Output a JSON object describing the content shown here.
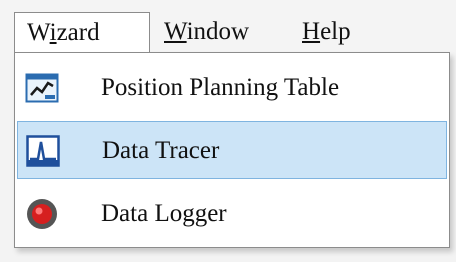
{
  "menubar": {
    "items": [
      {
        "before": "W",
        "mnemonic": "i",
        "after": "zard",
        "active": true
      },
      {
        "before": "",
        "mnemonic": "W",
        "after": "indow",
        "active": false
      },
      {
        "before": "",
        "mnemonic": "H",
        "after": "elp",
        "active": false
      }
    ]
  },
  "wizard_menu": {
    "items": [
      {
        "label": "Position Planning Table",
        "icon": "position-planning-table-icon",
        "highlighted": false
      },
      {
        "label": "Data Tracer",
        "icon": "data-tracer-icon",
        "highlighted": true
      },
      {
        "label": "Data Logger",
        "icon": "data-logger-icon",
        "highlighted": false
      }
    ]
  },
  "colors": {
    "highlight_bg": "#cce4f7",
    "highlight_border": "#7fb4e0",
    "logger_red": "#d61f1f"
  }
}
